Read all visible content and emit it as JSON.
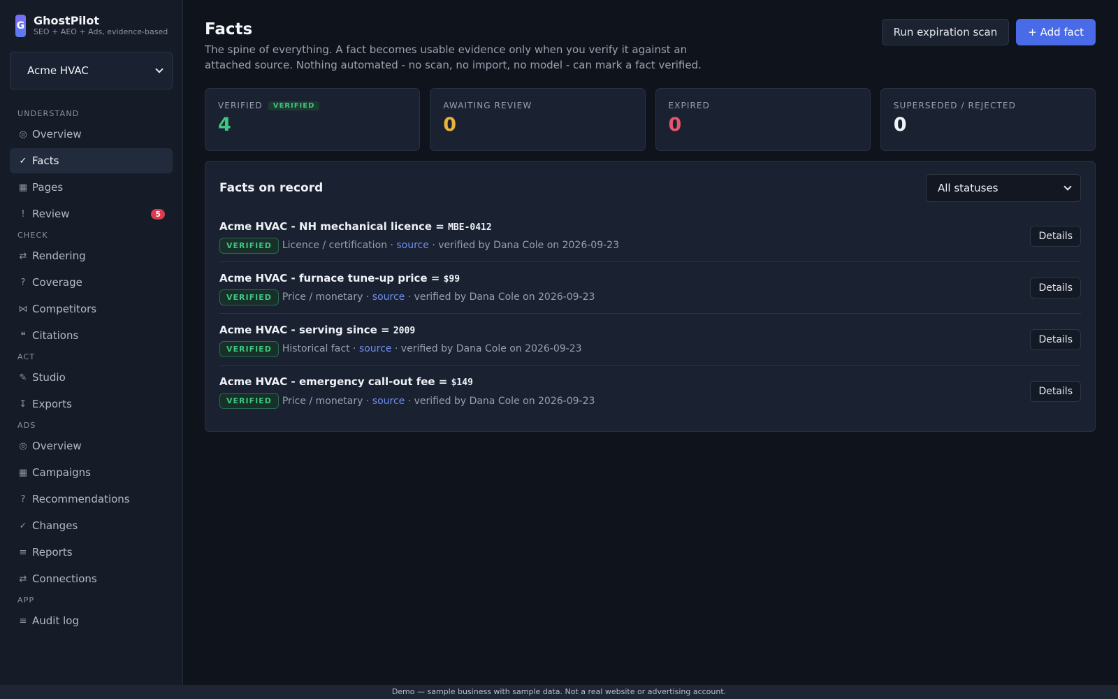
{
  "brand": {
    "logo_letter": "G",
    "name": "GhostPilot",
    "tagline": "SEO + AEO + Ads, evidence-based"
  },
  "business_selector": {
    "value": "Acme HVAC"
  },
  "sidebar": {
    "sections": [
      {
        "title": "UNDERSTAND",
        "items": [
          {
            "icon": "◎",
            "icon_name": "overview-icon",
            "label": "Overview"
          },
          {
            "icon": "✓",
            "icon_name": "check-icon",
            "label": "Facts",
            "active": true
          },
          {
            "icon": "▦",
            "icon_name": "pages-icon",
            "label": "Pages"
          },
          {
            "icon": "!",
            "icon_name": "alert-icon",
            "label": "Review",
            "badge": "5"
          }
        ]
      },
      {
        "title": "CHECK",
        "items": [
          {
            "icon": "⇄",
            "icon_name": "rendering-icon",
            "label": "Rendering"
          },
          {
            "icon": "?",
            "icon_name": "question-icon",
            "label": "Coverage"
          },
          {
            "icon": "⋈",
            "icon_name": "competitors-icon",
            "label": "Competitors"
          },
          {
            "icon": "❝",
            "icon_name": "quote-icon",
            "label": "Citations"
          }
        ]
      },
      {
        "title": "ACT",
        "items": [
          {
            "icon": "✎",
            "icon_name": "pencil-icon",
            "label": "Studio"
          },
          {
            "icon": "↧",
            "icon_name": "download-icon",
            "label": "Exports"
          }
        ]
      },
      {
        "title": "ADS",
        "items": [
          {
            "icon": "◎",
            "icon_name": "overview-icon",
            "label": "Overview"
          },
          {
            "icon": "▦",
            "icon_name": "campaigns-icon",
            "label": "Campaigns"
          },
          {
            "icon": "?",
            "icon_name": "question-icon",
            "label": "Recommendations"
          },
          {
            "icon": "✓",
            "icon_name": "check-icon",
            "label": "Changes"
          },
          {
            "icon": "≡",
            "icon_name": "list-icon",
            "label": "Reports"
          },
          {
            "icon": "⇄",
            "icon_name": "connections-icon",
            "label": "Connections"
          }
        ]
      },
      {
        "title": "APP",
        "items": [
          {
            "icon": "≡",
            "icon_name": "list-icon",
            "label": "Audit log"
          }
        ]
      }
    ]
  },
  "header": {
    "title": "Facts",
    "description": "The spine of everything. A fact becomes usable evidence only when you verify it against an attached source. Nothing automated - no scan, no import, no model - can mark a fact verified.",
    "run_scan_label": "Run expiration scan",
    "add_fact_label": "+ Add fact"
  },
  "stats": [
    {
      "label": "VERIFIED",
      "pill": "VERIFIED",
      "value": "4",
      "color": "#3fc681"
    },
    {
      "label": "AWAITING REVIEW",
      "value": "0",
      "color": "#e9b23c"
    },
    {
      "label": "EXPIRED",
      "value": "0",
      "color": "#e5566a"
    },
    {
      "label": "SUPERSEDED / REJECTED",
      "value": "0",
      "color": "#f1f4f9"
    }
  ],
  "facts_panel": {
    "title": "Facts on record",
    "filter_value": "All statuses",
    "details_label": "Details",
    "facts": [
      {
        "title": "Acme HVAC - NH mechanical licence = ",
        "value": "MBE-0412",
        "status": "VERIFIED",
        "category": "Licence / certification",
        "link": "source",
        "verified_text": "verified by Dana Cole on 2026-09-23"
      },
      {
        "title": "Acme HVAC - furnace tune-up price = ",
        "value": "$99",
        "status": "VERIFIED",
        "category": "Price / monetary",
        "link": "source",
        "verified_text": "verified by Dana Cole on 2026-09-23"
      },
      {
        "title": "Acme HVAC - serving since = ",
        "value": "2009",
        "status": "VERIFIED",
        "category": "Historical fact",
        "link": "source",
        "verified_text": "verified by Dana Cole on 2026-09-23"
      },
      {
        "title": "Acme HVAC - emergency call-out fee = ",
        "value": "$149",
        "status": "VERIFIED",
        "category": "Price / monetary",
        "link": "source",
        "verified_text": "verified by Dana Cole on 2026-09-23"
      }
    ]
  },
  "footer": {
    "text": "Demo — sample business with sample data. Not a real website or advertising account."
  }
}
